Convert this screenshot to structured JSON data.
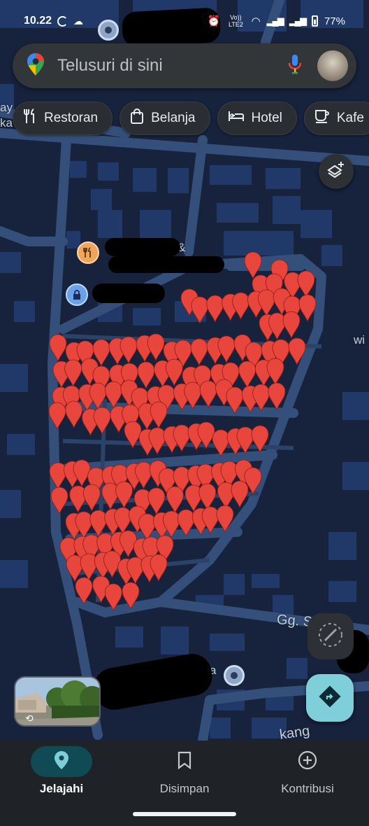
{
  "status_bar": {
    "time": "10.22",
    "network_label": "Vo)) LTE2",
    "battery": "77%"
  },
  "search": {
    "placeholder": "Telusuri di sini",
    "logo_icon": "google-maps-pin-icon",
    "mic_icon": "microphone-icon"
  },
  "chips": [
    {
      "label": "Restoran",
      "icon": "fork-knife-icon"
    },
    {
      "label": "Belanja",
      "icon": "shopping-bag-icon"
    },
    {
      "label": "Hotel",
      "icon": "bed-icon"
    },
    {
      "label": "Kafe",
      "icon": "coffee-cup-icon"
    }
  ],
  "map": {
    "labels": {
      "edge_left_1": "ay",
      "edge_left_2": "ka",
      "edge_right": "wi",
      "street_gg": "Gg. S",
      "street_bottom": "kang",
      "ampersand": "&",
      "partial_a": "a"
    },
    "poi_icons": [
      "restaurant-icon",
      "lock-icon",
      "place-marker-icon"
    ],
    "pin_color": "#e8453c",
    "pin_count": 165
  },
  "buttons": {
    "layers_icon": "layers-icon",
    "compass_icon": "compass-icon",
    "directions_icon": "directions-icon"
  },
  "bottom_nav": [
    {
      "label": "Jelajahi",
      "icon": "location-pin-icon",
      "active": true
    },
    {
      "label": "Disimpan",
      "icon": "bookmark-icon",
      "active": false
    },
    {
      "label": "Kontribusi",
      "icon": "add-circle-icon",
      "active": false
    }
  ]
}
